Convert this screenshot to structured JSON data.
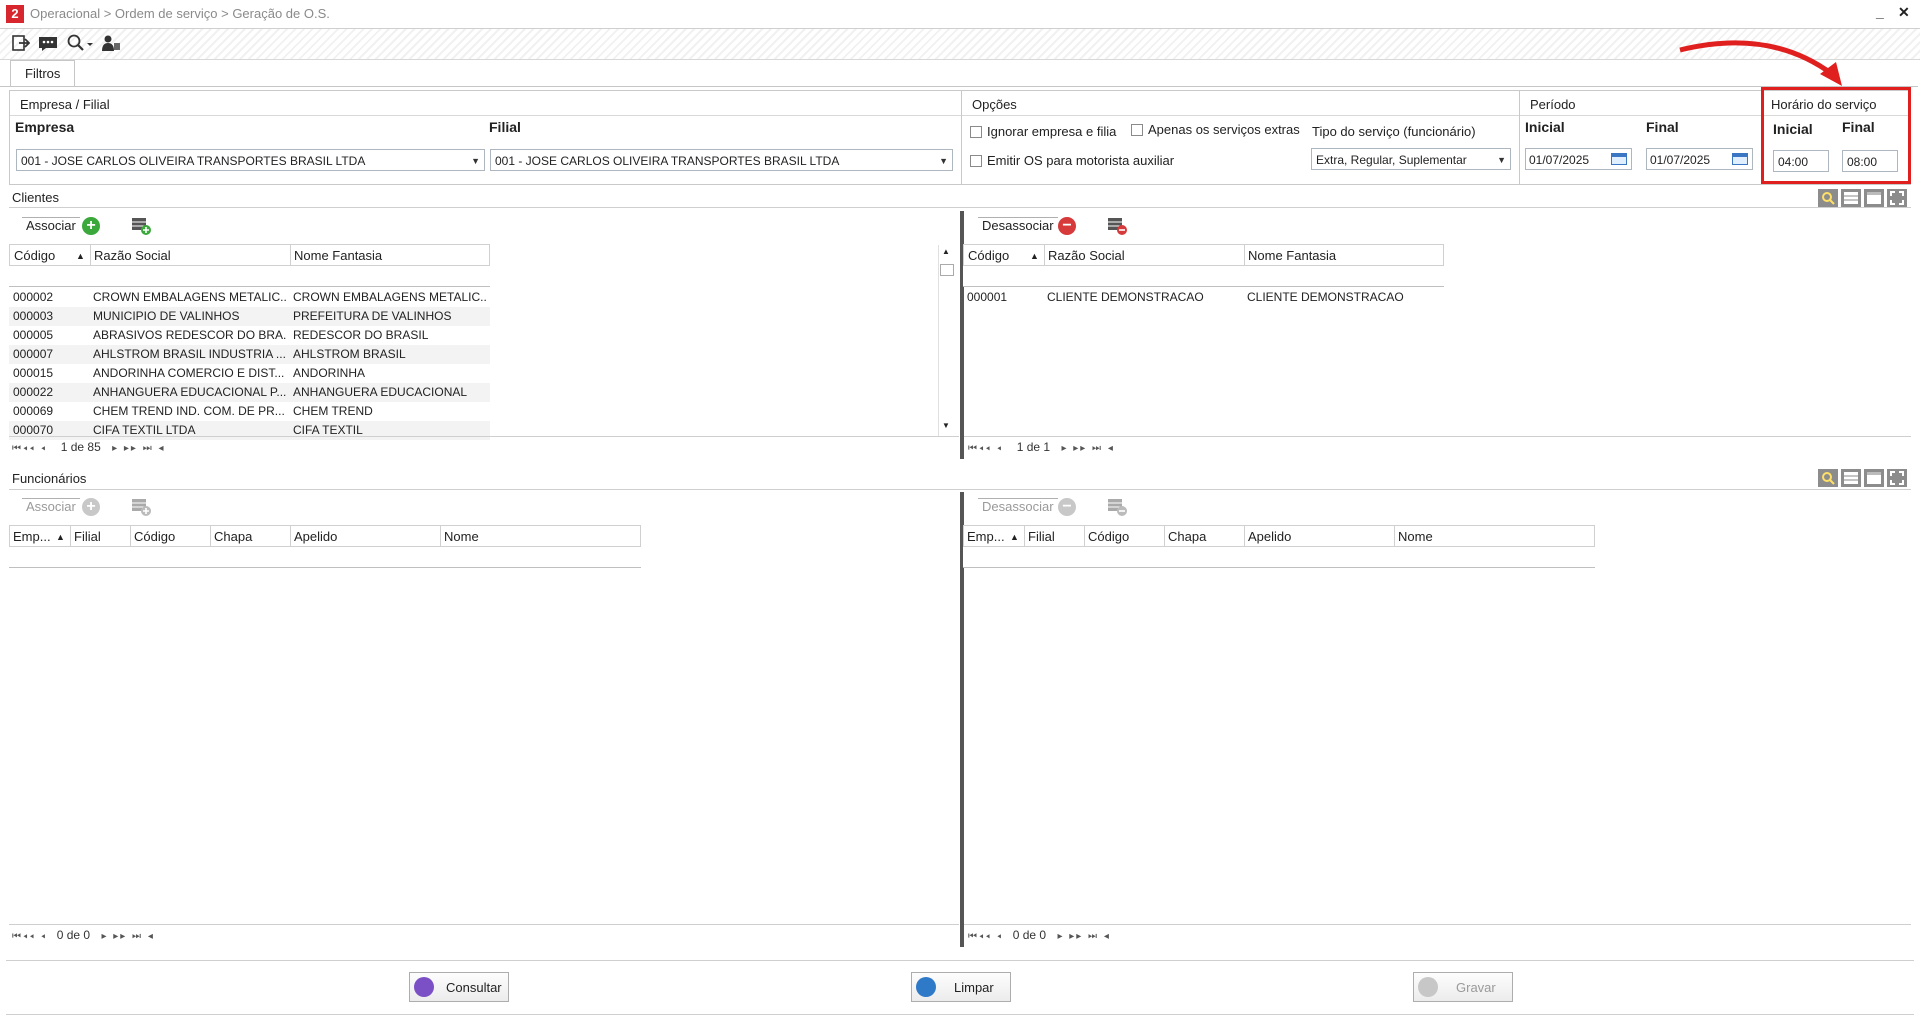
{
  "window": {
    "breadcrumb": "Operacional > Ordem de serviço > Geração de O.S.",
    "minimize": "_",
    "close": "✕"
  },
  "tabs": {
    "filtros": "Filtros"
  },
  "empresa_filial": {
    "title": "Empresa / Filial",
    "empresa_label": "Empresa",
    "empresa_value": "001 - JOSE CARLOS OLIVEIRA TRANSPORTES BRASIL LTDA",
    "filial_label": "Filial",
    "filial_value": "001 - JOSE CARLOS OLIVEIRA TRANSPORTES BRASIL LTDA"
  },
  "opcoes": {
    "title": "Opções",
    "ignorar": "Ignorar empresa e filia",
    "apenas_extras": "Apenas os serviços extras",
    "emitir_os": "Emitir OS para motorista auxiliar",
    "tipo_servico_label": "Tipo do serviço (funcionário)",
    "tipo_servico_value": "Extra, Regular, Suplementar"
  },
  "periodo": {
    "title": "Período",
    "inicial_label": "Inicial",
    "inicial_value": "01/07/2025",
    "final_label": "Final",
    "final_value": "01/07/2025"
  },
  "horario": {
    "title": "Horário do serviço",
    "inicial_label": "Inicial",
    "inicial_value": "04:00",
    "final_label": "Final",
    "final_value": "08:00"
  },
  "clientes": {
    "title": "Clientes",
    "associar": "Associar",
    "desassociar": "Desassociar",
    "columns": [
      "Código",
      "Razão Social",
      "Nome Fantasia"
    ],
    "left_rows": [
      [
        "000002",
        "CROWN EMBALAGENS METALIC...",
        "CROWN EMBALAGENS METALIC..."
      ],
      [
        "000003",
        "MUNICIPIO DE VALINHOS",
        "PREFEITURA DE VALINHOS"
      ],
      [
        "000005",
        "ABRASIVOS REDESCOR DO BRA...",
        "REDESCOR DO BRASIL"
      ],
      [
        "000007",
        "AHLSTROM BRASIL INDUSTRIA ...",
        "AHLSTROM BRASIL"
      ],
      [
        "000015",
        "ANDORINHA COMERCIO E DIST...",
        "ANDORINHA"
      ],
      [
        "000022",
        "ANHANGUERA EDUCACIONAL P...",
        "ANHANGUERA EDUCACIONAL"
      ],
      [
        "000069",
        "CHEM TREND IND. COM. DE PR...",
        "CHEM TREND"
      ],
      [
        "000070",
        "CIFA TEXTIL LTDA",
        "CIFA TEXTIL"
      ]
    ],
    "right_rows": [
      [
        "000001",
        "CLIENTE DEMONSTRACAO",
        "CLIENTE DEMONSTRACAO"
      ]
    ],
    "left_pager": "1 de 85",
    "right_pager": "1 de 1"
  },
  "funcionarios": {
    "title": "Funcionários",
    "associar": "Associar",
    "desassociar": "Desassociar",
    "columns": [
      "Emp...",
      "Filial",
      "Código",
      "Chapa",
      "Apelido",
      "Nome"
    ],
    "left_pager": "0 de 0",
    "right_pager": "0 de 0"
  },
  "footer": {
    "consultar": "Consultar",
    "limpar": "Limpar",
    "gravar": "Gravar"
  },
  "colors": {
    "accent": "#d7262e",
    "highlight": "#e0201f"
  }
}
